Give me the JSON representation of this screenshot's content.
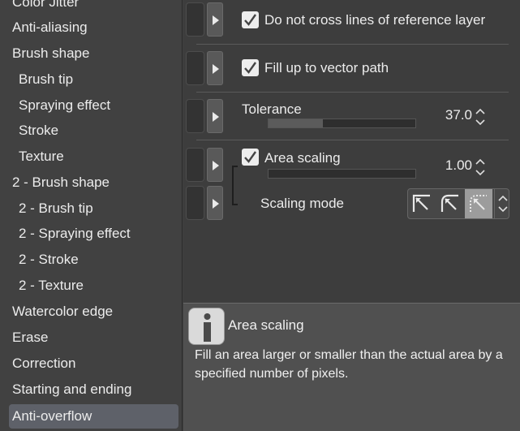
{
  "sidebar": {
    "items": [
      {
        "label": "Color Jitter"
      },
      {
        "label": "Anti-aliasing"
      },
      {
        "label": "Brush shape"
      },
      {
        "label": "Brush tip"
      },
      {
        "label": "Spraying effect"
      },
      {
        "label": "Stroke"
      },
      {
        "label": "Texture"
      },
      {
        "label": "2 - Brush shape"
      },
      {
        "label": "2 - Brush tip"
      },
      {
        "label": "2 - Spraying effect"
      },
      {
        "label": "2 - Stroke"
      },
      {
        "label": "2 - Texture"
      },
      {
        "label": "Watercolor edge"
      },
      {
        "label": "Erase"
      },
      {
        "label": "Correction"
      },
      {
        "label": "Starting and ending"
      },
      {
        "label": "Anti-overflow"
      }
    ],
    "selected": "Anti-overflow"
  },
  "settings": {
    "do_not_cross": {
      "label": "Do not cross lines of reference layer",
      "checked": true
    },
    "fill_vector": {
      "label": "Fill up to vector path",
      "checked": true
    },
    "tolerance": {
      "label": "Tolerance",
      "value": "37.0",
      "fraction": 0.37
    },
    "area_scaling": {
      "label": "Area scaling",
      "checked": true,
      "value": "1.00",
      "fraction": 0.5
    },
    "scaling_mode": {
      "label": "Scaling mode",
      "selected_index": 2,
      "icons": [
        "scale-sharp-icon",
        "scale-round-icon",
        "scale-dotted-icon"
      ]
    }
  },
  "help": {
    "icon": "info-icon",
    "title": "Area scaling",
    "description": "Fill an area larger or smaller than the actual area by a specified number of pixels."
  },
  "colors": {
    "selected_bg": "#5e6169",
    "panel_bg": "#3d3d3d",
    "help_bg": "#505050"
  }
}
